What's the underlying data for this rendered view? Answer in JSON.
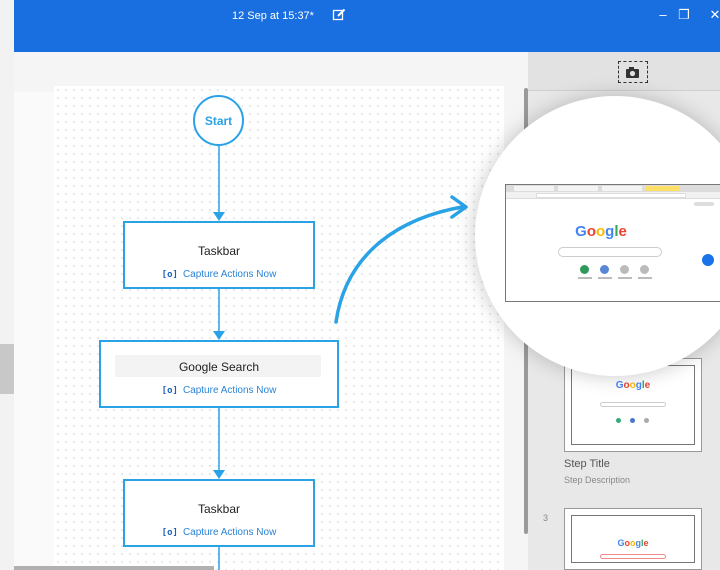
{
  "window": {
    "title": "12 Sep at 15:37*",
    "minimize_glyph": "–",
    "maximize_glyph": "❐",
    "close_glyph": "✕"
  },
  "flowchart": {
    "start_label": "Start",
    "nodes": [
      {
        "title": "Taskbar",
        "capture_label": "Capture Actions Now"
      },
      {
        "title": "Google Search",
        "capture_label": "Capture Actions Now"
      },
      {
        "title": "Taskbar",
        "capture_label": "Capture Actions Now"
      }
    ],
    "capture_icon": "[o]"
  },
  "steps_panel": {
    "camera_icon": "camera-icon",
    "steps": [
      {
        "number": "",
        "title": "Step Title",
        "description": "Step Description",
        "logo": "Google"
      },
      {
        "number": "3",
        "logo": "Google"
      }
    ]
  },
  "zoom_preview": {
    "logo": "Google"
  },
  "colors": {
    "titlebar": "#1a6fe0",
    "flow_accent": "#2aa2e6",
    "capture_link": "#2a84d6"
  }
}
